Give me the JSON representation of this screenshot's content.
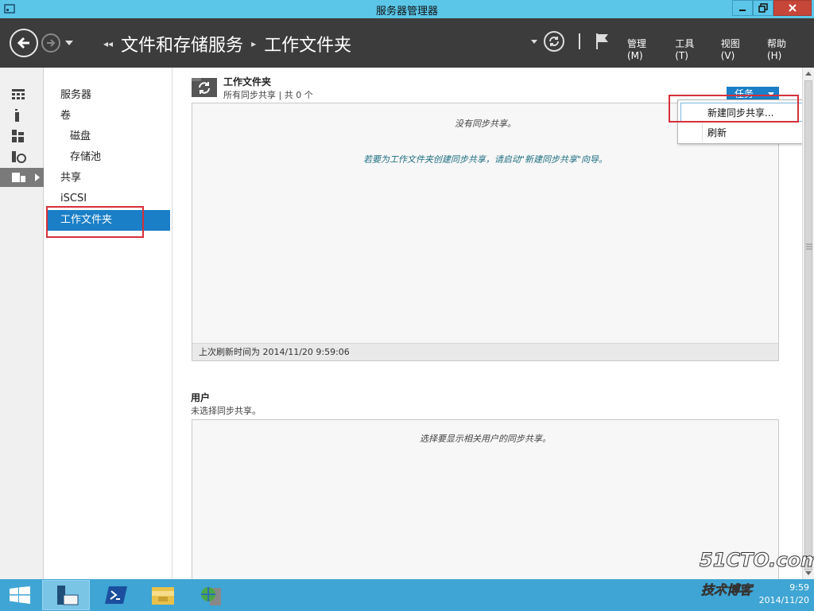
{
  "window": {
    "title": "服务器管理器"
  },
  "nav": {
    "breadcrumb": [
      "文件和存储服务",
      "工作文件夹"
    ],
    "menus": [
      "管理(M)",
      "工具(T)",
      "视图(V)",
      "帮助(H)"
    ]
  },
  "tree": {
    "items": [
      {
        "label": "服务器"
      },
      {
        "label": "卷"
      },
      {
        "label": "磁盘"
      },
      {
        "label": "存储池"
      },
      {
        "label": "共享"
      },
      {
        "label": "iSCSI"
      },
      {
        "label": "工作文件夹"
      }
    ]
  },
  "work_folders": {
    "title": "工作文件夹",
    "subtitle": "所有同步共享 | 共 0 个",
    "tasks_label": "任务",
    "empty_message": "没有同步共享。",
    "hint_message": "若要为工作文件夹创建同步共享，请启动\"新建同步共享\"向导。",
    "last_refresh": "上次刷新时间为 2014/11/20 9:59:06"
  },
  "tasks_menu": {
    "items": [
      "新建同步共享...",
      "刷新"
    ]
  },
  "users": {
    "title": "用户",
    "subtitle": "未选择同步共享。",
    "empty_message": "选择要显示相关用户的同步共享。"
  },
  "taskbar": {
    "time": "9:59",
    "date": "2014/11/20"
  },
  "watermark": {
    "line1": "51CTO.com",
    "line2": "技术博客"
  },
  "colors": {
    "titlebar": "#5bc6e8",
    "navbar": "#3c3c3c",
    "accent": "#1a7fc7",
    "highlight_box": "#d6303a",
    "taskbar": "#3fa5d4"
  }
}
